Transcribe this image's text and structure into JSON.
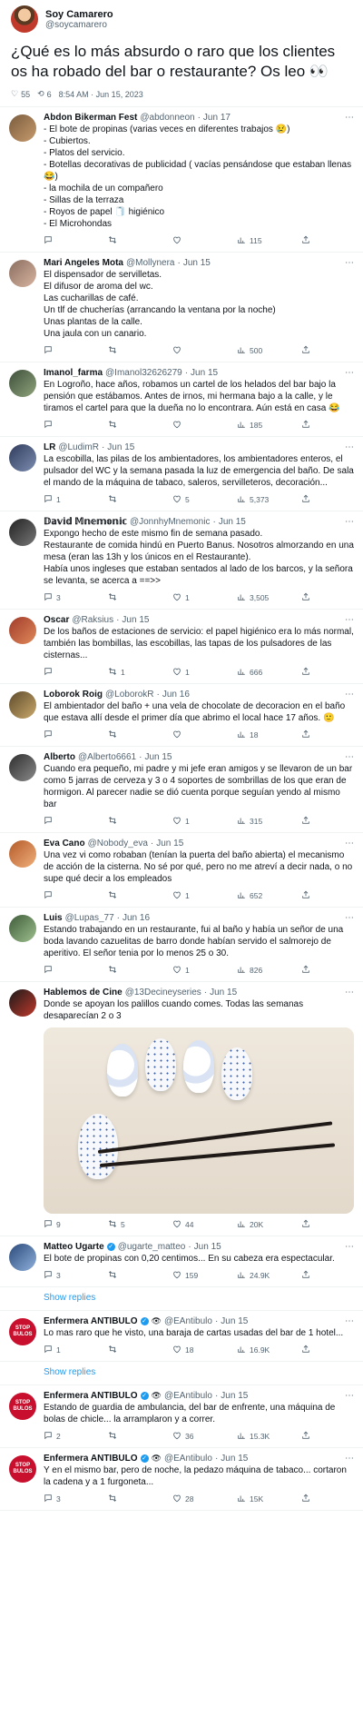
{
  "op": {
    "name": "Soy Camarero",
    "handle": "@soycamarero",
    "text": "¿Qué es lo más absurdo o raro que los clientes os ha robado del bar o restaurante? Os leo 👀",
    "likes": "55",
    "retweets": "6",
    "time": "8:54 AM · Jun 15, 2023"
  },
  "replies": [
    {
      "name": "Abdon Bikerman Fest",
      "handle": "@abdonneon",
      "date": "Jun 17",
      "text": "- El bote de propinas (varias veces en diferentes trabajos 😢)\n- Cubiertos.\n- Platos del servicio.\n- Botellas decorativas de publicidad ( vacías pensándose que estaban llenas 😂)\n- la mochila de un compañero\n- Sillas de la terraza\n- Royos de papel 🧻 higiénico\n- El Microhondas",
      "replies": "",
      "retweets": "",
      "likes": "",
      "views": "115"
    },
    {
      "name": "Mari Angeles Mota",
      "handle": "@Mollynera",
      "date": "Jun 15",
      "text": "El dispensador de servilletas.\nEl difusor de aroma del wc.\nLas cucharillas de café.\nUn tlf de chucherías (arrancando la ventana por la noche)\nUnas plantas de la calle.\nUna jaula con un canario.",
      "replies": "",
      "retweets": "",
      "likes": "",
      "views": "500"
    },
    {
      "name": "Imanol_farma",
      "handle": "@Imanol32626279",
      "date": "Jun 15",
      "text": "En Logroño, hace años, robamos un cartel de los helados del bar bajo la pensión que estábamos. Antes de irnos, mi hermana bajo a la calle, y le tiramos el cartel para que la dueña no lo encontrara. Aún está en casa 😂",
      "replies": "",
      "retweets": "",
      "likes": "",
      "views": "185"
    },
    {
      "name": "LR",
      "handle": "@LudimR",
      "date": "Jun 15",
      "text": "La escobilla, las pilas de los ambientadores, los ambientadores enteros, el pulsador del WC y la semana pasada la luz de emergencia del baño. De sala el mando de la máquina de tabaco, saleros, servilleteros, decoración...",
      "replies": "1",
      "retweets": "",
      "likes": "5",
      "views": "5,373"
    },
    {
      "name": "𝔻𝕒𝕧𝕚𝕕 𝕄𝕟𝕖𝕞𝕠𝕟𝕚𝕔",
      "handle": "@JonnhyMnemonic",
      "date": "Jun 15",
      "text": "Expongo hecho de este mismo fin de semana pasado.\nRestaurante de comida hindú en Puerto Banus. Nosotros almorzando en una mesa (eran las 13h y los únicos en el Restaurante).\nHabía unos ingleses que estaban sentados al lado de los barcos, y la señora se levanta, se acerca a ==>>",
      "replies": "3",
      "retweets": "",
      "likes": "1",
      "views": "3,505"
    },
    {
      "name": "Oscar",
      "handle": "@Raksius",
      "date": "Jun 15",
      "text": "De los baños de estaciones de servicio: el papel higiénico era lo más normal, también las bombillas, las escobillas, las tapas de los pulsadores de las cisternas...",
      "replies": "",
      "retweets": "1",
      "likes": "1",
      "views": "666"
    },
    {
      "name": "Loborok Roig",
      "handle": "@LoborokR",
      "date": "Jun 16",
      "text": "El ambientador del baño + una vela de chocolate de decoracion en el baño que estava allí desde el primer día que abrimo el local hace 17 años. 🙂",
      "replies": "",
      "retweets": "",
      "likes": "",
      "views": "18"
    },
    {
      "name": "Alberto",
      "handle": "@Alberto6661",
      "date": "Jun 15",
      "text": "Cuando era pequeño, mi padre y mi jefe eran amigos y se llevaron de un bar como 5 jarras de cerveza y 3 o 4 soportes de sombrillas de los que eran de hormigon. Al parecer nadie se dió cuenta porque seguían yendo al mismo bar",
      "replies": "",
      "retweets": "",
      "likes": "1",
      "views": "315"
    },
    {
      "name": "Eva Cano",
      "handle": "@Nobody_eva",
      "date": "Jun 15",
      "text": "Una vez vi como robaban (tenían la puerta del baño abierta) el mecanismo de acción de la cisterna. No sé por qué, pero no me atreví a decir nada, o no supe qué decir a los empleados",
      "replies": "",
      "retweets": "",
      "likes": "1",
      "views": "652"
    },
    {
      "name": "Luis",
      "handle": "@Lupas_77",
      "date": "Jun 16",
      "text": "Estando trabajando en un restaurante, fui al baño y había un señor de una boda lavando cazuelitas de barro donde habían servido el salmorejo de aperitivo. El señor tenia por lo menos 25 o 30.",
      "replies": "",
      "retweets": "",
      "likes": "1",
      "views": "826"
    }
  ],
  "photo_reply": {
    "name": "Hablemos de Cine",
    "handle": "@13Decineyseries",
    "date": "Jun 15",
    "text": "Donde se apoyan los palillos cuando comes. Todas las semanas desaparecían 2 o 3",
    "replies": "9",
    "retweets": "5",
    "likes": "44",
    "views": "20K"
  },
  "matteo": {
    "name": "Matteo Ugarte",
    "handle": "@ugarte_matteo",
    "date": "Jun 15",
    "text": "El bote de propinas con 0,20 centimos... En su cabeza era espectacular.",
    "replies": "3",
    "retweets": "",
    "likes": "159",
    "views": "24.9K"
  },
  "enfermera": [
    {
      "name": "Enfermera ANTIBULO",
      "eye": "👁",
      "handle": "@EAntibulo",
      "date": "Jun 15",
      "text": "Lo mas raro que he visto, una baraja de cartas usadas del bar de 1 hotel...",
      "replies": "1",
      "retweets": "",
      "likes": "18",
      "views": "16.9K"
    },
    {
      "name": "Enfermera ANTIBULO",
      "eye": "👁",
      "handle": "@EAntibulo",
      "date": "Jun 15",
      "text": "Estando de guardia de ambulancia, del bar de enfrente, una máquina de bolas de chicle... la arramplaron y a correr.",
      "replies": "2",
      "retweets": "",
      "likes": "36",
      "views": "15.3K"
    },
    {
      "name": "Enfermera ANTIBULO",
      "eye": "👁",
      "handle": "@EAntibulo",
      "date": "Jun 15",
      "text": "Y en el mismo bar, pero de noche, la pedazo máquina de tabaco... cortaron la cadena y a 1 furgoneta...",
      "replies": "3",
      "retweets": "",
      "likes": "28",
      "views": "15K"
    }
  ],
  "show_replies": "Show replies",
  "stop_text": "STOP BULOS"
}
